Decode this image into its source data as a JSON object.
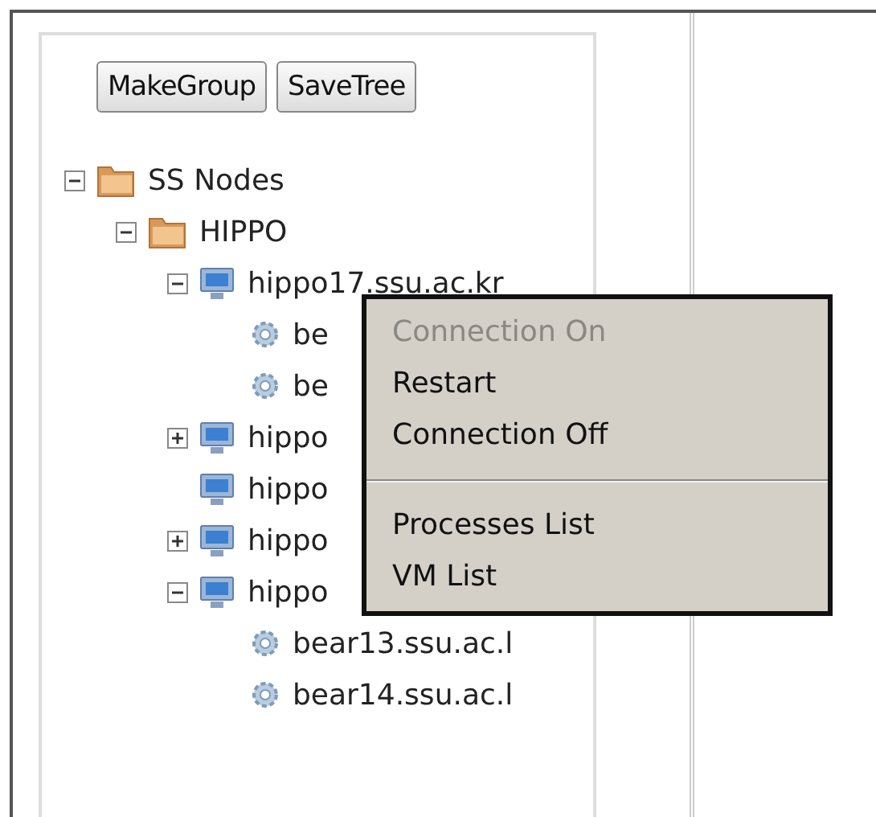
{
  "toolbar": {
    "buttons": [
      "MakeGroup",
      "SaveTree"
    ]
  },
  "tree": [
    {
      "kind": "group",
      "label": "SS Nodes",
      "expanded": true,
      "children": [
        {
          "kind": "group",
          "label": "HIPPO",
          "expanded": true,
          "children": [
            {
              "kind": "host",
              "label": "hippo17.ssu.ac.kr",
              "expanded": true,
              "children": [
                {
                  "kind": "vm",
                  "label": "be"
                },
                {
                  "kind": "vm",
                  "label": "be"
                }
              ]
            },
            {
              "kind": "host",
              "label": "hippo",
              "expanded": false
            },
            {
              "kind": "host",
              "label": "hippo"
            },
            {
              "kind": "host",
              "label": "hippo",
              "expanded": false
            },
            {
              "kind": "host",
              "label": "hippo",
              "expanded": true,
              "children": [
                {
                  "kind": "vm",
                  "label": "bear13.ssu.ac.l"
                },
                {
                  "kind": "vm",
                  "label": "bear14.ssu.ac.l"
                }
              ]
            }
          ]
        }
      ]
    }
  ],
  "context_menu": {
    "groups": [
      [
        {
          "label": "Connection On",
          "disabled": true
        },
        {
          "label": "Restart",
          "disabled": false
        },
        {
          "label": "Connection Off",
          "disabled": false
        }
      ],
      [
        {
          "label": "Processes List",
          "disabled": false
        },
        {
          "label": "VM List",
          "disabled": false
        }
      ]
    ]
  }
}
